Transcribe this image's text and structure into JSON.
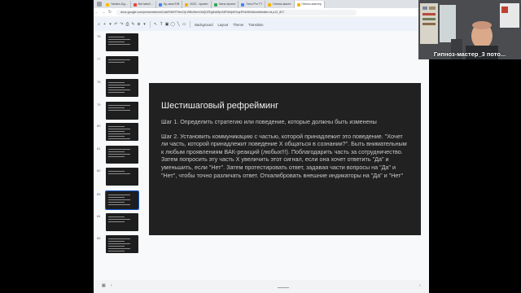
{
  "browser": {
    "tabs": [
      {
        "label": "Yandex.Ид...",
        "favicon_color": "#fbbc04"
      },
      {
        "label": "Not tabs!!...",
        "favicon_color": "#ea4335"
      },
      {
        "label": "Ку-чкни Е!B",
        "favicon_color": "#4285f4"
      },
      {
        "label": "2022 - проект",
        "favicon_color": "#f4b400"
      },
      {
        "label": "Чаты проект",
        "favicon_color": "#34a853"
      },
      {
        "label": "Голо.Pro TT",
        "favicon_color": "#4285f4"
      },
      {
        "label": "Гипноз-масте",
        "favicon_color": "#f4b400"
      },
      {
        "label": "Гипноз-мастер",
        "favicon_color": "#f4b400",
        "active": true
      }
    ],
    "url": "docs.google.com/presentation/d/1aMY8hR7hbnOjI-WBo9bmVsfQ0ZEg5oMfp1NlF0k3pfDVqrtPzk0lWdA/edit#slide=id.p12_827"
  },
  "toolbar": {
    "items": [
      "Background",
      "Layout",
      "Theme",
      "Transition"
    ]
  },
  "filmstrip": {
    "slide_numbers": [
      "76",
      "77",
      "78",
      "79",
      "80",
      "81",
      "82",
      "83",
      "84",
      "85"
    ],
    "selected_index": 7
  },
  "slide": {
    "title": "Шестишаговый рефрейминг",
    "paragraphs": [
      "Шаг 1. Определить стратегию или поведение, которые должны быть изменены",
      "Шаг 2. Установить коммуникацию с частью, которой принадлежит это поведение. \"Хочет ли часть, которой принадлежит поведение Х общаться в сознании?\". Быть внимательным к любым проявлениям ВАК-реакций (любых!!!). Поблагодарить часть за сотрудничество. Затем попросить эту часть Х увеличить этот сигнал, если она хочет ответить \"Да\" и уменьшить, если \"Нет\". Затем протестировать ответ, задавая части вопросы на \"Да\" и \"Нет\", чтобы точно различать ответ. Откалибровать внешние индикаторы на \"Да\" и \"Нет\""
    ]
  },
  "webcam": {
    "caption": "Гипноз-мастер_3 пото..."
  }
}
